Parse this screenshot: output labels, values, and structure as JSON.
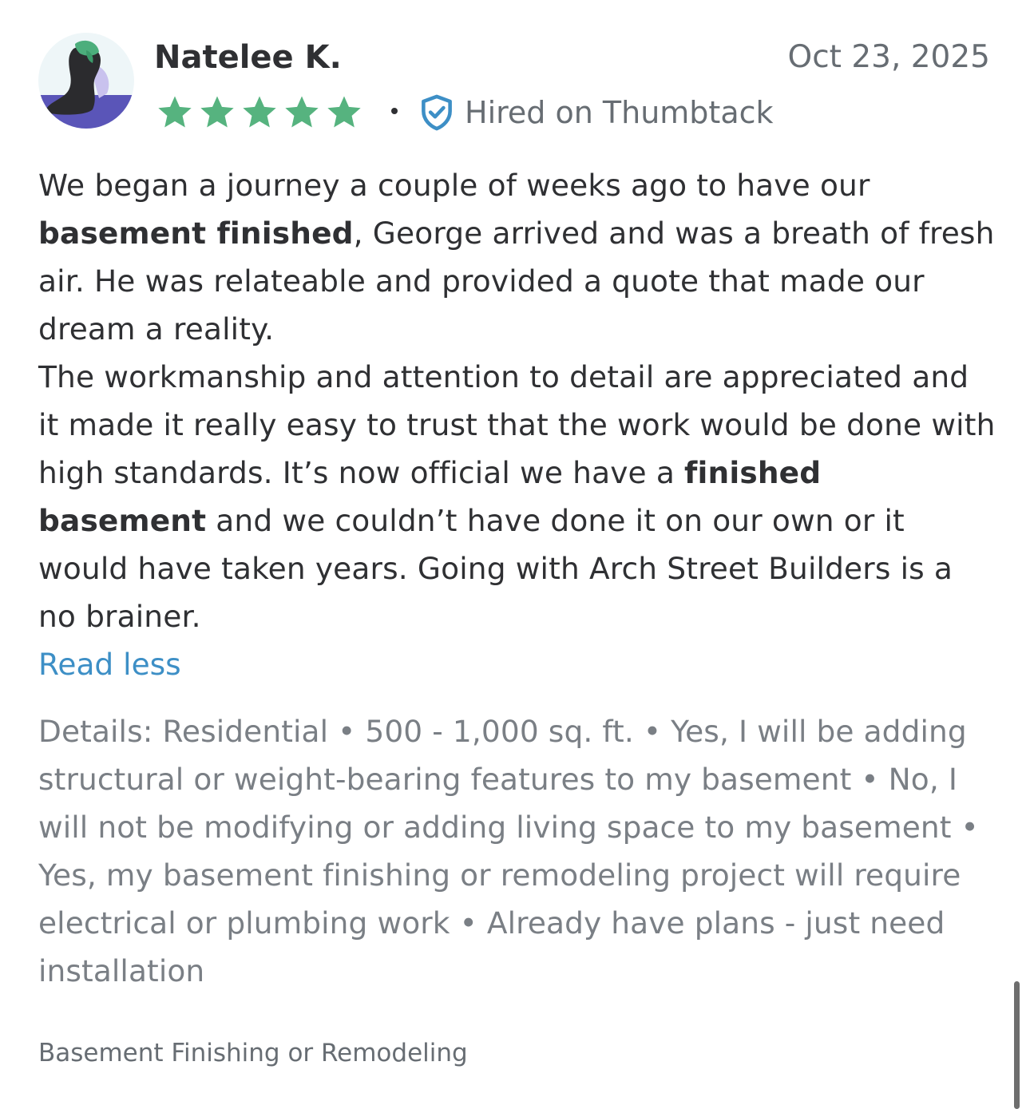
{
  "review": {
    "reviewer_name": "Natelee K.",
    "date": "Oct 23, 2025",
    "rating": 5,
    "rating_max": 5,
    "star_color": "#56b37f",
    "badge_icon": "shield-check-icon",
    "badge_color": "#3d8fc6",
    "hired_label": "Hired on Thumbtack",
    "body": {
      "p1_part1": "We began a journey a couple of weeks ago to have our ",
      "p1_bold": "basement finished",
      "p1_part2": ", George arrived and was a breath of fresh air. He was relateable and provided a quote that made our dream a reality.",
      "p2_part1": "The workmanship and attention to detail are appreciated and it made it really easy to trust that the work would be done with high standards. It’s now official we have a ",
      "p2_bold": "finished basement",
      "p2_part2": " and we couldn’t have done it on our own or it would have taken years. Going with Arch Street Builders is a no brainer."
    },
    "read_less_label": "Read less",
    "details_text": "Details: Residential • 500 - 1,000 sq. ft. • Yes, I will be adding structural or weight-bearing features to my basement • No, I will not be modifying or adding living space to my basement • Yes, my basement finishing or remodeling project will require electrical or plumbing work • Already have plans - just need installation",
    "category": "Basement Finishing or Remodeling"
  }
}
